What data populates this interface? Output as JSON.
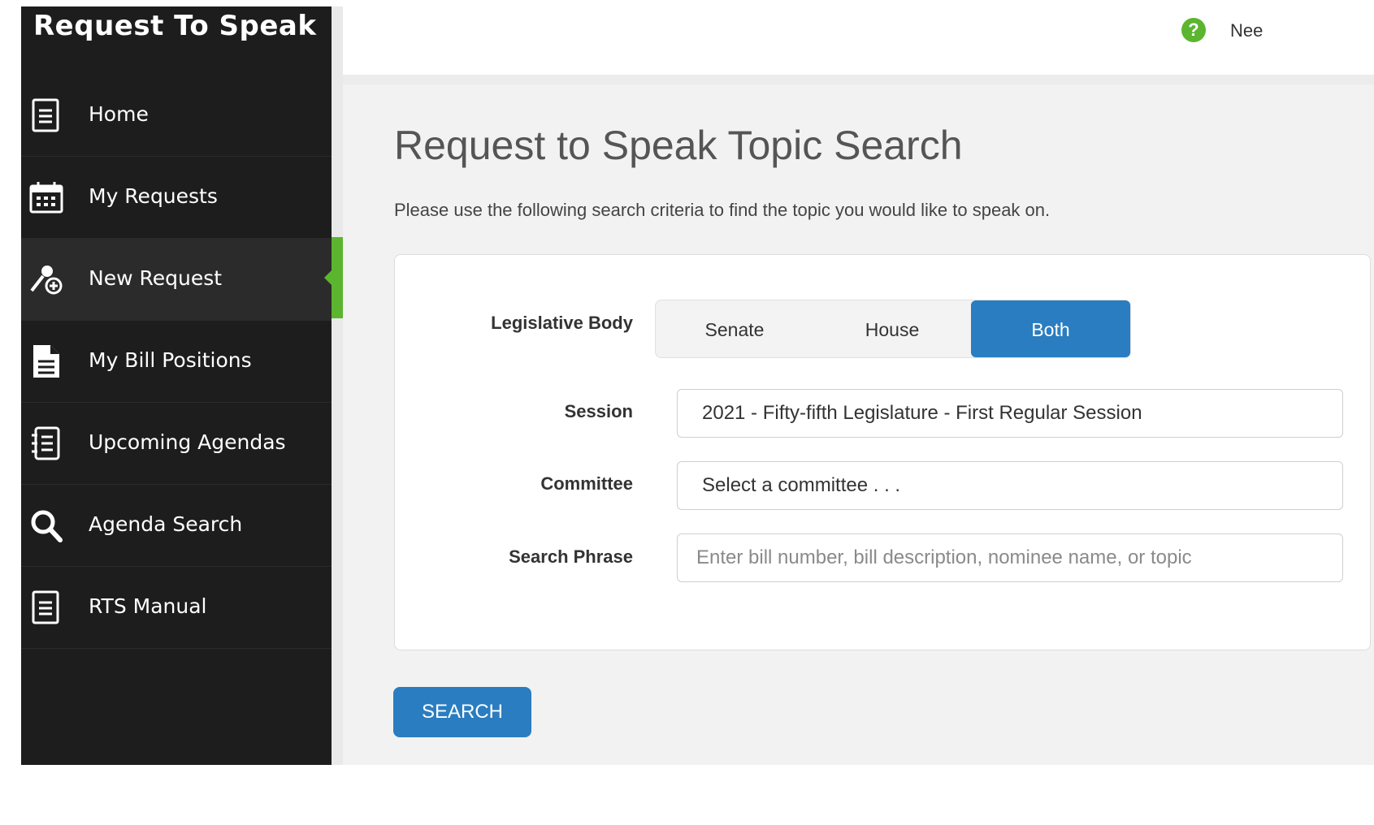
{
  "app": {
    "title": "Request To Speak"
  },
  "sidebar": {
    "items": [
      {
        "label": "Home"
      },
      {
        "label": "My Requests"
      },
      {
        "label": "New Request"
      },
      {
        "label": "My Bill Positions"
      },
      {
        "label": "Upcoming Agendas"
      },
      {
        "label": "Agenda Search"
      },
      {
        "label": "RTS Manual"
      }
    ]
  },
  "topbar": {
    "help_text": "Nee"
  },
  "main": {
    "title": "Request to Speak Topic Search",
    "description": "Please use the following search criteria to find the topic you would like to speak on.",
    "form": {
      "legislative_body_label": "Legislative Body",
      "options": [
        "Senate",
        "House",
        "Both"
      ],
      "selected_option": "Both",
      "session_label": "Session",
      "session_value": "2021 - Fifty-fifth Legislature - First Regular Session",
      "committee_label": "Committee",
      "committee_value": "Select a committee . . .",
      "search_phrase_label": "Search Phrase",
      "search_phrase_placeholder": "Enter bill number, bill description, nominee name, or topic"
    },
    "search_button": "SEARCH"
  },
  "colors": {
    "accent": "#2a7dc0",
    "active": "#5cb52e",
    "sidebar": "#1d1d1d"
  }
}
